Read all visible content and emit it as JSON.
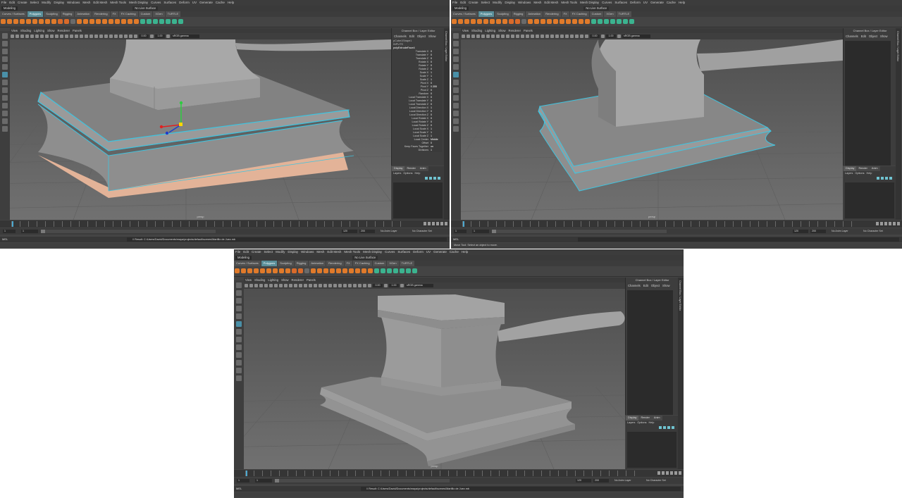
{
  "menus": [
    "File",
    "Edit",
    "Create",
    "Select",
    "Modify",
    "Display",
    "Windows",
    "Mesh",
    "Edit Mesh",
    "Mesh Tools",
    "Mesh Display",
    "Curves",
    "Surfaces",
    "Deform",
    "UV",
    "Generate",
    "Cache",
    "Help"
  ],
  "mode": "Modeling",
  "live_surface": "No Live Surface",
  "shelf_tabs": [
    "Curves / Surfaces",
    "Polygons",
    "Sculpting",
    "Rigging",
    "Animation",
    "Rendering",
    "FX",
    "FX Caching",
    "Custom",
    "XGen",
    "TURTLE"
  ],
  "shelf_active": "Polygons",
  "panel_menu": [
    "View",
    "Shading",
    "Lighting",
    "Show",
    "Renderer",
    "Panels"
  ],
  "viewport_fields": {
    "val1": "0.00",
    "val2": "1.00",
    "colorspace": "sRGB gamma"
  },
  "viewport_label": "persp",
  "channel_box": {
    "title": "Channel Box / Layer Editor",
    "menu": [
      "Channels",
      "Edit",
      "Object",
      "Show"
    ],
    "object": "pCube1Shape1",
    "inputs": "INPUTS",
    "node": "polyExtrudeFace4",
    "attrs": [
      {
        "name": "Translate X",
        "value": "0"
      },
      {
        "name": "Translate Y",
        "value": "0"
      },
      {
        "name": "Translate Z",
        "value": "0"
      },
      {
        "name": "Rotate X",
        "value": "0"
      },
      {
        "name": "Rotate Y",
        "value": "0"
      },
      {
        "name": "Rotate Z",
        "value": "0"
      },
      {
        "name": "Scale X",
        "value": "1"
      },
      {
        "name": "Scale Y",
        "value": "1"
      },
      {
        "name": "Scale Z",
        "value": "1"
      },
      {
        "name": "Pivot X",
        "value": "0"
      },
      {
        "name": "Pivot Y",
        "value": "0.355"
      },
      {
        "name": "Pivot Z",
        "value": "0"
      },
      {
        "name": "Random",
        "value": "0"
      },
      {
        "name": "Local Translate X",
        "value": "0"
      },
      {
        "name": "Local Translate Y",
        "value": "0"
      },
      {
        "name": "Local Translate Z",
        "value": "0"
      },
      {
        "name": "Local Direction X",
        "value": "1"
      },
      {
        "name": "Local Direction Y",
        "value": "0"
      },
      {
        "name": "Local Direction Z",
        "value": "0"
      },
      {
        "name": "Local Rotate X",
        "value": "0"
      },
      {
        "name": "Local Rotate Y",
        "value": "0"
      },
      {
        "name": "Local Rotate Z",
        "value": "0"
      },
      {
        "name": "Local Scale X",
        "value": "1"
      },
      {
        "name": "Local Scale Y",
        "value": "1"
      },
      {
        "name": "Local Scale Z",
        "value": "1"
      },
      {
        "name": "Local Center",
        "value": "Middle"
      },
      {
        "name": "Offset",
        "value": "0"
      },
      {
        "name": "Keep Faces Together",
        "value": "on"
      },
      {
        "name": "Divisions",
        "value": "1"
      }
    ]
  },
  "side_tab": "Channel Box / Layer Editor",
  "side_tab2": "Modeling Toolkit",
  "layers": {
    "tabs": [
      "Display",
      "Render",
      "Anim"
    ],
    "menu": [
      "Layers",
      "Options",
      "Help"
    ]
  },
  "range": {
    "start": "1",
    "inner_start": "1",
    "inner_end": "120",
    "end": "120",
    "max": "200",
    "anim_layer": "No Anim Layer",
    "char_set": "No Character Set"
  },
  "command": {
    "label": "MEL",
    "result": "// Result: C:/Users/David/Documents/maya/projects/default/scenes/Martillo de Juez.mb"
  },
  "help_line": "Move Tool: Select an object to move."
}
